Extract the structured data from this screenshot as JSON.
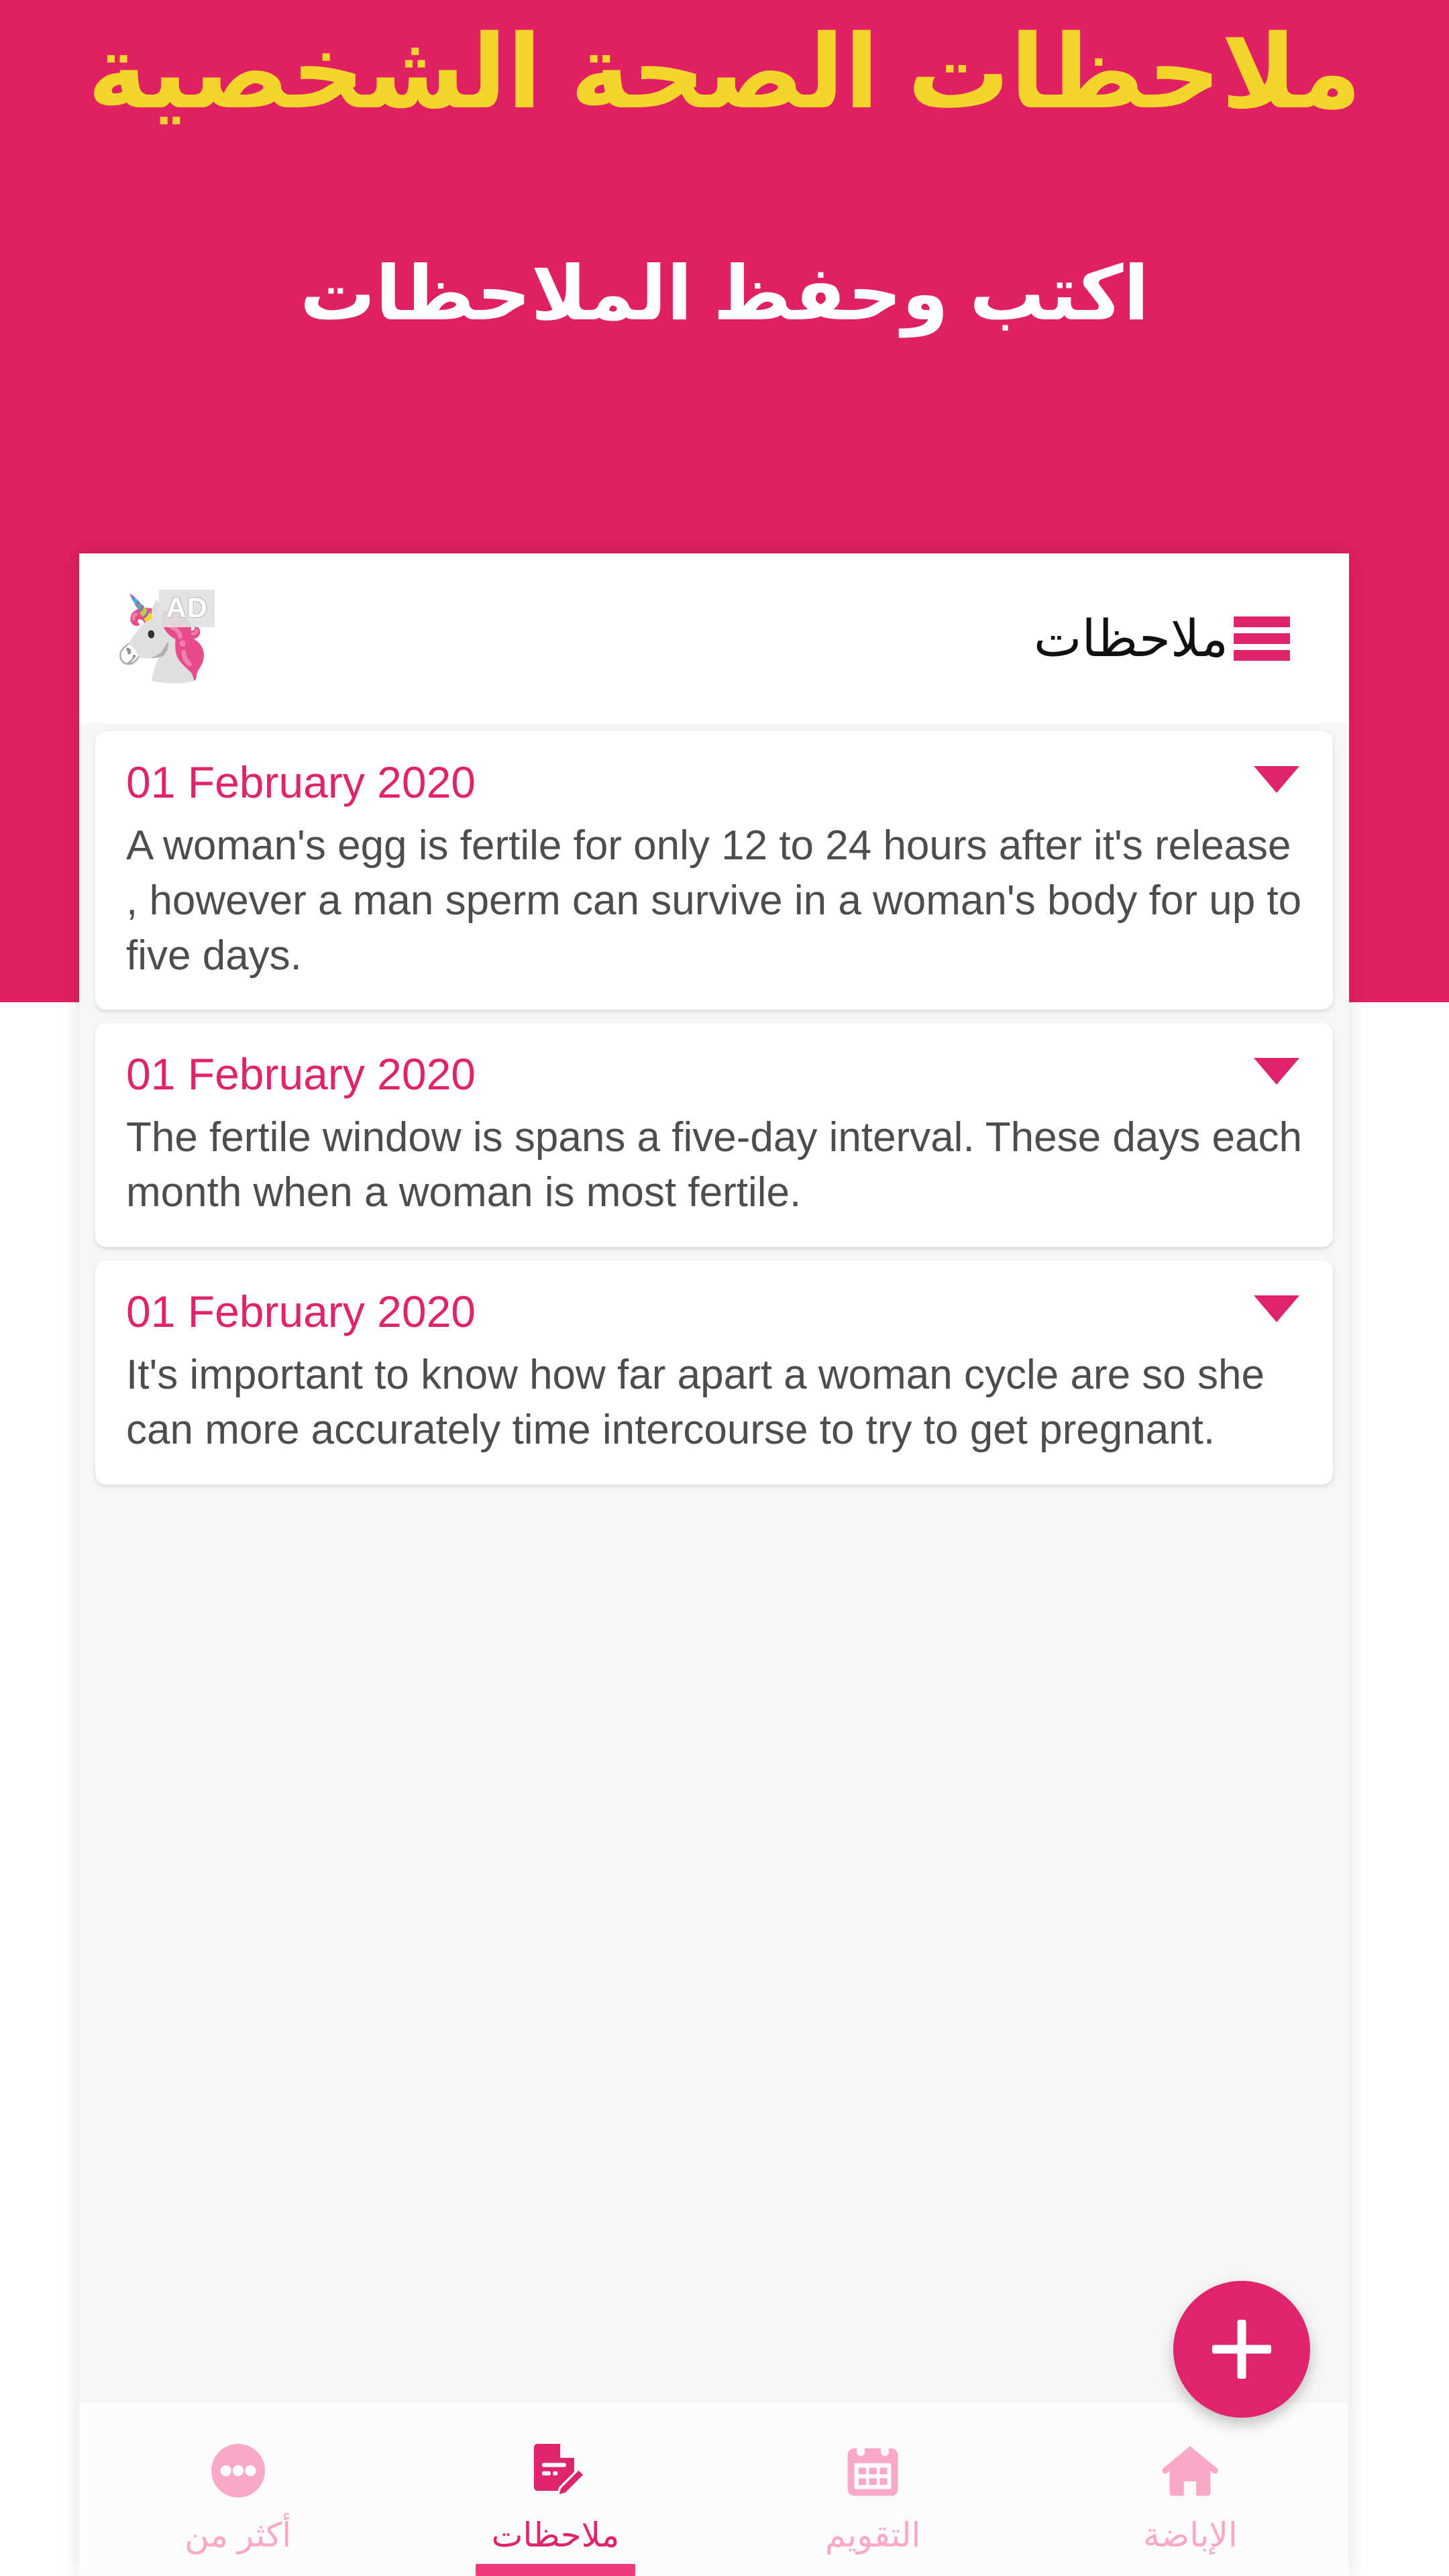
{
  "promo": {
    "title": "ملاحظات الصحة الشخصية",
    "subtitle": "اكتب وحفظ الملاحظات",
    "title_color": "#f4d52b",
    "subtitle_color": "#ffffff",
    "background_color": "#e02063"
  },
  "appbar": {
    "menu_icon": "hamburger-menu-icon",
    "title": "ملاحظات",
    "ad_label": "AD",
    "ad_image": "🦄",
    "background_color": "#ffffff",
    "title_color": "#101010",
    "accent_color": "#e0246b"
  },
  "notes": [
    {
      "date": "01 February 2020",
      "text": "A woman's egg is fertile for only 12 to 24 hours after it's release , however a man sperm can survive in a woman's body for up to five days.",
      "expand_icon": "caret-down-icon"
    },
    {
      "date": "01 February 2020",
      "text": "The fertile window is spans a five-day interval. These days each month when a woman is most fertile.",
      "expand_icon": "caret-down-icon"
    },
    {
      "date": "01 February 2020",
      "text": "It's important to know how far apart a woman cycle are so she can more accurately time intercourse to try to get pregnant.",
      "expand_icon": "caret-down-icon"
    }
  ],
  "fab": {
    "icon": "plus-icon",
    "color": "#e0246b"
  },
  "bottom_nav": {
    "active_index": 2,
    "inactive_color": "#f9a8c8",
    "active_color": "#e0246b",
    "items": [
      {
        "label": "الإباضة",
        "icon": "home-icon",
        "active": false
      },
      {
        "label": "التقويم",
        "icon": "calendar-icon",
        "active": false
      },
      {
        "label": "ملاحظات",
        "icon": "note-edit-icon",
        "active": true
      },
      {
        "label": "أكثر من",
        "icon": "more-dots-icon",
        "active": false
      }
    ]
  }
}
